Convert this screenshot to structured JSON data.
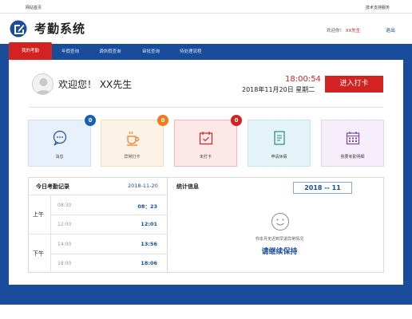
{
  "topbar": {
    "left_link": "网站首页",
    "right_link": "技术支持服务"
  },
  "header": {
    "title": "考勤系统",
    "user_prefix": "欢迎你！",
    "user_name": "XX先生",
    "logout_label": "退出"
  },
  "nav": {
    "items": [
      {
        "label": "我的考勤",
        "active": true
      },
      {
        "label": "年假查询",
        "active": false
      },
      {
        "label": "调休假查询",
        "active": false
      },
      {
        "label": "审批查询",
        "active": false
      },
      {
        "label": "待处理流程",
        "active": false
      }
    ]
  },
  "welcome": {
    "greeting": "欢迎您！ XX先生",
    "time": "18:00:54",
    "date": "2018年11月20日  星期二",
    "clockin_label": "进入打卡"
  },
  "cards": [
    {
      "label": "消息",
      "badge": "0",
      "badge_color": "#1a5fb4",
      "bg": "#e8f1fb",
      "border": "#cfe0f3",
      "icon": "chat-icon",
      "icon_color": "#1a4c9c"
    },
    {
      "label": "异常打卡",
      "badge": "0",
      "badge_color": "#f07b18",
      "bg": "#fdf2e6",
      "border": "#f3dcc2",
      "icon": "coffee-icon",
      "icon_color": "#f07b18"
    },
    {
      "label": "未打卡",
      "badge": "0",
      "badge_color": "#d32222",
      "bg": "#fde8e8",
      "border": "#f1b8b8",
      "icon": "calendar-check-icon",
      "icon_color": "#d32222"
    },
    {
      "label": "申请休假",
      "badge": "",
      "badge_color": "",
      "bg": "#e3f3f8",
      "border": "#c6e6ef",
      "icon": "document-icon",
      "icon_color": "#2a8a7a"
    },
    {
      "label": "我要考勤明细",
      "badge": "",
      "badge_color": "",
      "bg": "#f7eefb",
      "border": "#e6d4ef",
      "icon": "calendar-grid-icon",
      "icon_color": "#7a4aa6"
    }
  ],
  "today": {
    "title": "今日考勤记录",
    "date": "2018-11-20",
    "am_label": "上午",
    "pm_label": "下午",
    "rows": [
      {
        "scheduled": "08:30",
        "actual": "08：23"
      },
      {
        "scheduled": "12:00",
        "actual": "12:01"
      },
      {
        "scheduled": "14:00",
        "actual": "13:56"
      },
      {
        "scheduled": "18:00",
        "actual": "18:06"
      }
    ]
  },
  "stats": {
    "title": "统计信息",
    "month": "2018 -- 11",
    "message": "你本月无迟到早退异常情况",
    "keep_up": "请继续保持"
  }
}
